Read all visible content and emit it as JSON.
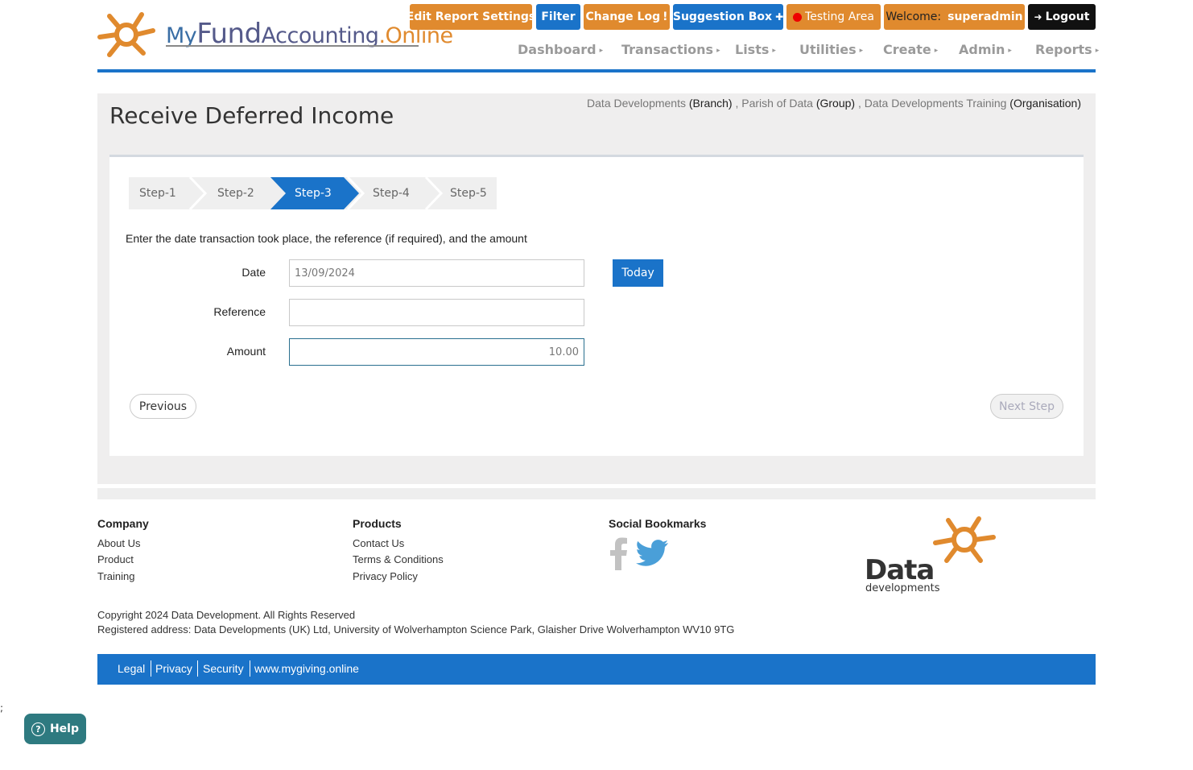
{
  "header": {
    "logo": {
      "my": "My",
      "fund": "Fund",
      "accounting": "Accounting",
      "dot_online": ".Online"
    },
    "buttons": {
      "edit_report_settings": "Edit Report Settings",
      "filter": "Filter",
      "change_log": "Change Log",
      "change_log_icon": "!",
      "suggestion_box": "Suggestion Box",
      "suggestion_icon": "✚",
      "testing_area": "Testing Area",
      "welcome_label": "Welcome:",
      "welcome_user": "superadmin",
      "logout": "Logout"
    },
    "nav": [
      "Dashboard",
      "Transactions",
      "Lists",
      "Utilities",
      "Create",
      "Admin",
      "Reports"
    ],
    "colors": {
      "brand_blue": "#1a73c9",
      "brand_orange": "#e08a2e"
    }
  },
  "page": {
    "title": "Receive Deferred Income",
    "breadcrumb": {
      "branch_name": "Data Developments",
      "branch_type": "(Branch)",
      "group_name": "Parish of Data",
      "group_type": "(Group)",
      "org_name": "Data Developments Training",
      "org_type": "(Organisation)",
      "sep": ","
    },
    "steps": [
      "Step-1",
      "Step-2",
      "Step-3",
      "Step-4",
      "Step-5"
    ],
    "active_step": "Step-3",
    "instruction": "Enter the date transaction took place, the reference (if required), and the amount",
    "form": {
      "date_label": "Date",
      "date_value": "13/09/2024",
      "today_button": "Today",
      "reference_label": "Reference",
      "reference_value": "",
      "amount_label": "Amount",
      "amount_value": "10.00"
    },
    "previous_button": "Previous",
    "next_button": "Next Step"
  },
  "footer": {
    "company": {
      "heading": "Company",
      "links": [
        "About Us",
        "Product",
        "Training"
      ]
    },
    "products": {
      "heading": "Products",
      "links": [
        "Contact Us",
        "Terms & Conditions",
        "Privacy Policy"
      ]
    },
    "social": {
      "heading": "Social Bookmarks",
      "icons": [
        "facebook-icon",
        "twitter-icon"
      ]
    },
    "brand": {
      "name": "Data",
      "sub": "developments"
    },
    "copyright": "Copyright 2024 Data Development. All Rights Reserved",
    "address": "Registered address: Data Developments (UK) Ltd, University of Wolverhampton Science Park, Glaisher Drive Wolverhampton WV10 9TG",
    "bottom_links": [
      "Legal",
      "Privacy",
      "Security",
      "www.mygiving.online"
    ]
  },
  "stray_text": ";",
  "help_button": "Help"
}
